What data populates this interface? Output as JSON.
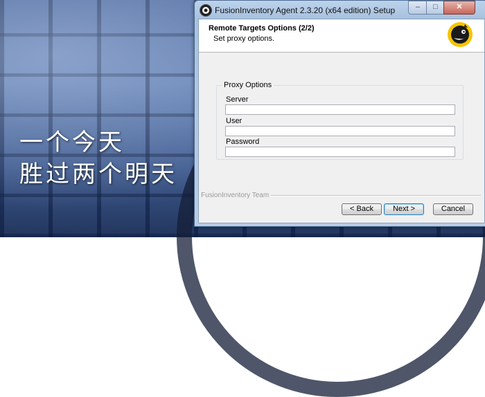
{
  "desktop": {
    "poem_line1": "一个今天",
    "poem_line2": "胜过两个明天"
  },
  "window": {
    "title": "FusionInventory Agent 2.3.20 (x64 edition) Setup",
    "caption_buttons": {
      "minimize": "–",
      "maximize": "□",
      "close": "✕"
    }
  },
  "header": {
    "title": "Remote Targets Options (2/2)",
    "subtitle": "Set proxy options.",
    "logo_icon": "fusioninventory-logo-icon"
  },
  "proxy_group": {
    "legend": "Proxy Options",
    "fields": [
      {
        "label": "Server",
        "value": ""
      },
      {
        "label": "User",
        "value": ""
      },
      {
        "label": "Password",
        "value": ""
      }
    ]
  },
  "branding": "FusionInventory Team",
  "buttons": {
    "back": "< Back",
    "next": "Next >",
    "cancel": "Cancel"
  },
  "colors": {
    "logo_bg": "#f5c400",
    "window_frame": "#a9c2df"
  }
}
